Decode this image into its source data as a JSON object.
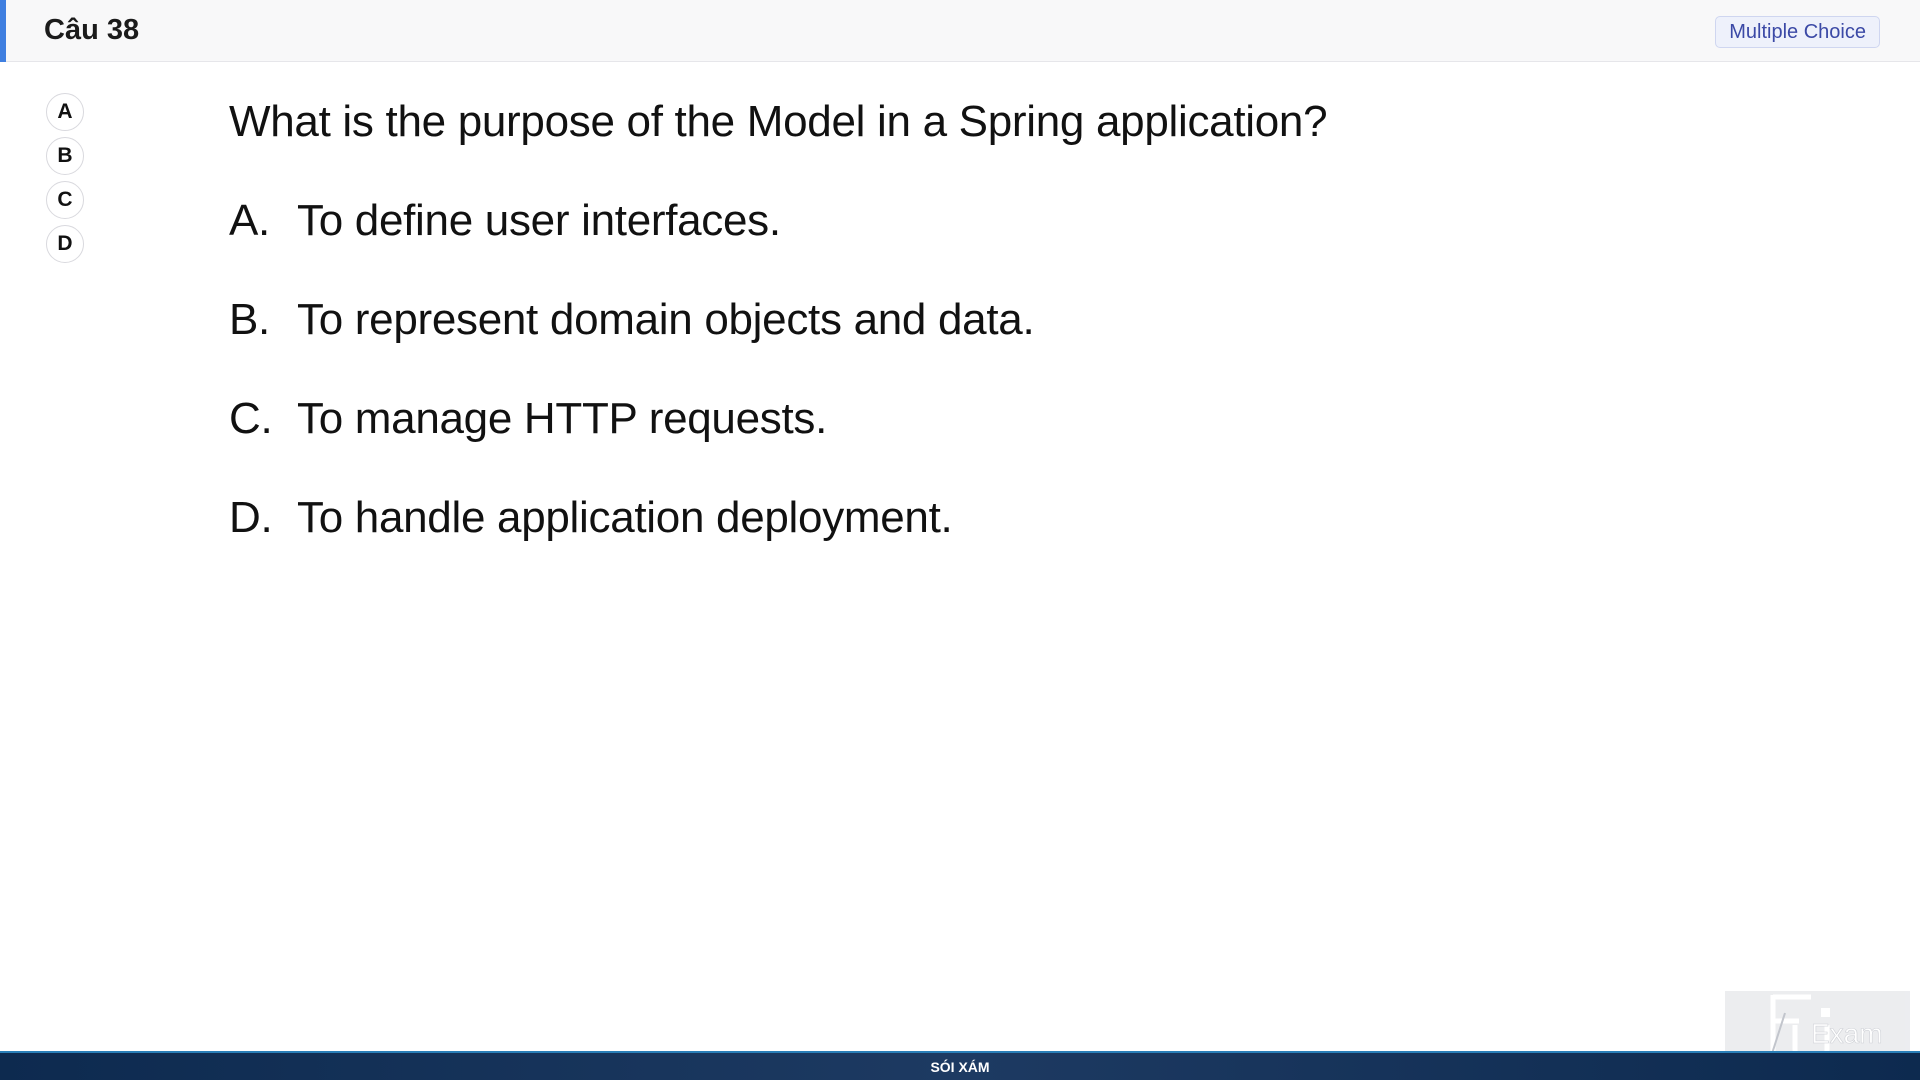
{
  "header": {
    "question_title": "Câu 38",
    "type_badge": "Multiple Choice"
  },
  "choices": [
    {
      "label": "A"
    },
    {
      "label": "B"
    },
    {
      "label": "C"
    },
    {
      "label": "D"
    }
  ],
  "question": {
    "text": "What is the purpose of the Model in a Spring application?",
    "options": [
      {
        "letter": "A.",
        "text": "To define user interfaces."
      },
      {
        "letter": "B.",
        "text": "To represent domain objects and data."
      },
      {
        "letter": "C.",
        "text": "To manage HTTP requests."
      },
      {
        "letter": "D.",
        "text": "To handle application deployment."
      }
    ]
  },
  "footer": {
    "text": "SÓI XÁM"
  },
  "logo": {
    "text": "Exam",
    "icon": "fu-exam-logo-icon"
  },
  "colors": {
    "accent": "#3f7fe0",
    "badge_text": "#3b49a6",
    "footer_bg": "#0d2a4f"
  }
}
